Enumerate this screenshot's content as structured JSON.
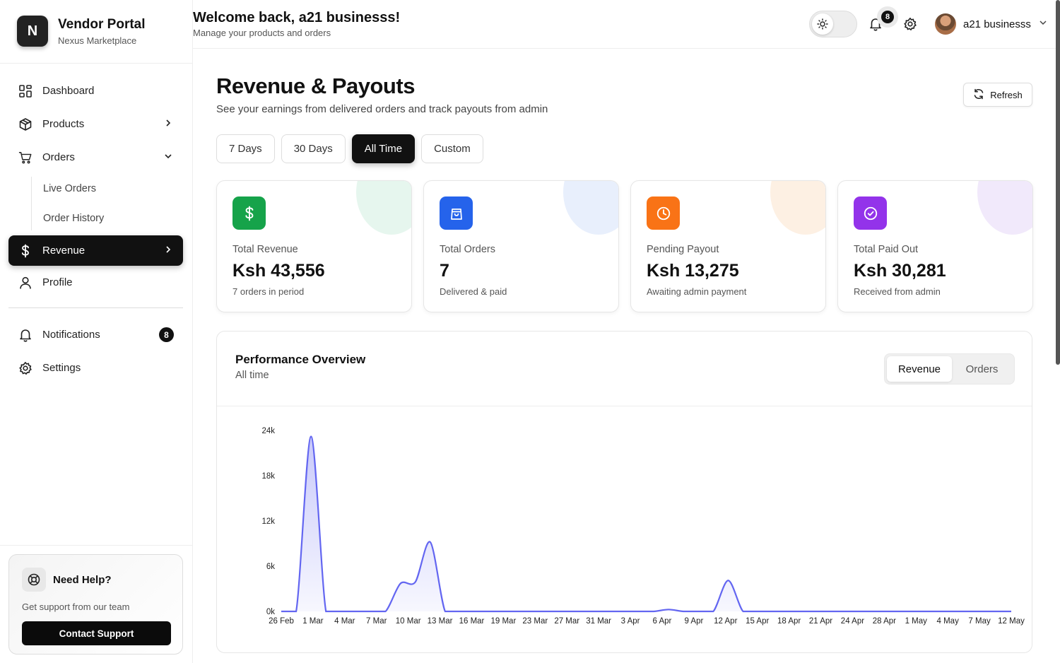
{
  "brand": {
    "logo_letter": "N",
    "name": "Vendor Portal",
    "subtitle": "Nexus Marketplace"
  },
  "sidebar": {
    "dashboard": "Dashboard",
    "products": "Products",
    "orders": "Orders",
    "orders_sub": [
      "Live Orders",
      "Order History"
    ],
    "revenue": "Revenue",
    "profile": "Profile",
    "notifications": "Notifications",
    "notifications_count": "8",
    "settings": "Settings"
  },
  "help": {
    "title": "Need Help?",
    "text": "Get support from our team",
    "button": "Contact Support"
  },
  "header": {
    "welcome": "Welcome back, a21 businesss!",
    "subtitle": "Manage your products and orders",
    "notification_count": "8",
    "user_name": "a21 businesss"
  },
  "page": {
    "title": "Revenue & Payouts",
    "subtitle": "See your earnings from delivered orders and track payouts from admin",
    "refresh": "Refresh",
    "filters": [
      "7 Days",
      "30 Days",
      "All Time",
      "Custom"
    ],
    "active_filter": "All Time"
  },
  "cards": [
    {
      "label": "Total Revenue",
      "value": "Ksh 43,556",
      "note": "7 orders in period",
      "color": "#16a34a",
      "blob": "#e6f6ee",
      "icon": "dollar-icon"
    },
    {
      "label": "Total Orders",
      "value": "7",
      "note": "Delivered & paid",
      "color": "#2563eb",
      "blob": "#e8effc",
      "icon": "shopping-bag-icon"
    },
    {
      "label": "Pending Payout",
      "value": "Ksh 13,275",
      "note": "Awaiting admin payment",
      "color": "#f97316",
      "blob": "#fdf0e3",
      "icon": "clock-icon"
    },
    {
      "label": "Total Paid Out",
      "value": "Ksh 30,281",
      "note": "Received from admin",
      "color": "#9333ea",
      "blob": "#f1e9fb",
      "icon": "check-circle-icon"
    }
  ],
  "performance": {
    "title": "Performance Overview",
    "subtitle": "All time",
    "toggle": [
      "Revenue",
      "Orders"
    ],
    "active_toggle": "Revenue"
  },
  "chart_data": {
    "type": "area",
    "x": [
      "26 Feb",
      "1 Mar",
      "4 Mar",
      "7 Mar",
      "10 Mar",
      "13 Mar",
      "16 Mar",
      "19 Mar",
      "23 Mar",
      "27 Mar",
      "31 Mar",
      "3 Apr",
      "6 Apr",
      "9 Apr",
      "12 Apr",
      "15 Apr",
      "18 Apr",
      "21 Apr",
      "24 Apr",
      "28 Apr",
      "1 May",
      "4 May",
      "7 May",
      "12 May"
    ],
    "series": [
      {
        "values": [
          0,
          0,
          23200,
          0,
          0,
          0,
          0,
          0,
          3700,
          3900,
          9200,
          0,
          0,
          0,
          0,
          0,
          0,
          0,
          0,
          0,
          0,
          0,
          0,
          0,
          0,
          0,
          250,
          0,
          0,
          0,
          4100,
          0,
          0,
          0,
          0,
          0,
          0,
          0,
          0,
          0,
          0,
          0,
          0,
          0,
          0,
          0,
          0,
          0,
          0,
          0
        ]
      }
    ],
    "yticks": [
      "0k",
      "6k",
      "12k",
      "18k",
      "24k"
    ],
    "ylim": [
      0,
      24000
    ],
    "color": "#6366f1",
    "grid": false
  }
}
